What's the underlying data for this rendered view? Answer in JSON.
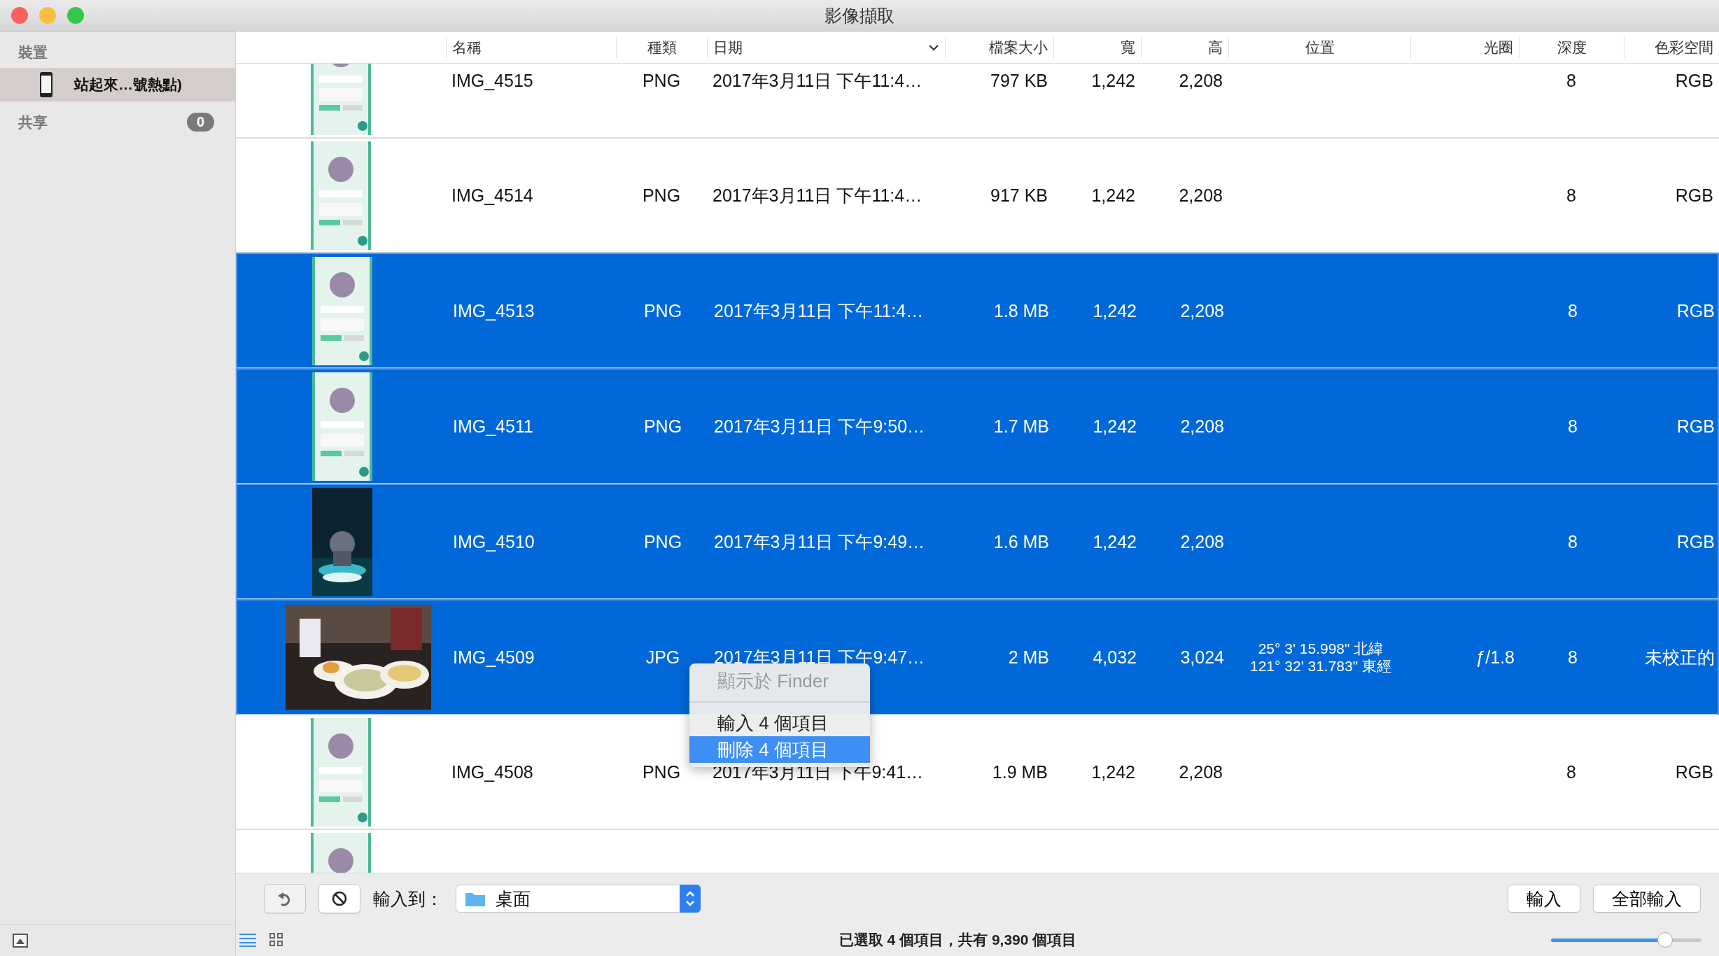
{
  "window": {
    "title": "影像擷取"
  },
  "sidebar": {
    "sections": [
      {
        "title": "裝置",
        "items": [
          {
            "label": "站起來…號熱點)",
            "selected": true,
            "kind": "device"
          }
        ]
      },
      {
        "title": "共享",
        "badge": "0"
      }
    ]
  },
  "table": {
    "columns": [
      {
        "label": "名稱"
      },
      {
        "label": "種類"
      },
      {
        "label": "日期",
        "sorted": true
      },
      {
        "label": "檔案大小"
      },
      {
        "label": "寬"
      },
      {
        "label": "高"
      },
      {
        "label": "位置"
      },
      {
        "label": "光圈"
      },
      {
        "label": "深度"
      },
      {
        "label": "色彩空間"
      }
    ],
    "rows": [
      {
        "selected": false,
        "cells": [
          "IMG_4515",
          "PNG",
          "2017年3月11日 下午11:4…",
          "797 KB",
          "1,242",
          "2,208",
          "",
          "",
          "8",
          "RGB"
        ]
      },
      {
        "selected": false,
        "cells": [
          "IMG_4514",
          "PNG",
          "2017年3月11日 下午11:4…",
          "917 KB",
          "1,242",
          "2,208",
          "",
          "",
          "8",
          "RGB"
        ]
      },
      {
        "selected": true,
        "cells": [
          "IMG_4513",
          "PNG",
          "2017年3月11日 下午11:4…",
          "1.8 MB",
          "1,242",
          "2,208",
          "",
          "",
          "8",
          "RGB"
        ]
      },
      {
        "selected": true,
        "cells": [
          "IMG_4511",
          "PNG",
          "2017年3月11日 下午9:50…",
          "1.7 MB",
          "1,242",
          "2,208",
          "",
          "",
          "8",
          "RGB"
        ]
      },
      {
        "selected": true,
        "cells": [
          "IMG_4510",
          "PNG",
          "2017年3月11日 下午9:49…",
          "1.6 MB",
          "1,242",
          "2,208",
          "",
          "",
          "8",
          "RGB"
        ]
      },
      {
        "selected": true,
        "cells": [
          "IMG_4509",
          "JPG",
          "2017年3月11日 下午9:47…",
          "2 MB",
          "4,032",
          "3,024",
          "25° 3' 15.998\" 北緯\n121° 32' 31.783\" 東經",
          "ƒ/1.8",
          "8",
          "未校正的"
        ]
      },
      {
        "selected": false,
        "cells": [
          "IMG_4508",
          "PNG",
          "2017年3月11日 下午9:41…",
          "1.9 MB",
          "1,242",
          "2,208",
          "",
          "",
          "8",
          "RGB"
        ]
      },
      {
        "selected": false
      }
    ]
  },
  "context_menu": {
    "items": [
      {
        "kind": "item",
        "label": "顯示於 Finder",
        "disabled": true,
        "selected": false
      },
      {
        "kind": "separator"
      },
      {
        "kind": "item",
        "label": "輸入 4 個項目",
        "disabled": false,
        "selected": false
      },
      {
        "kind": "item",
        "label": "刪除 4 個項目",
        "disabled": false,
        "selected": true
      }
    ]
  },
  "toolbar": {
    "import_to_label": "輸入到：",
    "destination": "桌面",
    "import_button": "輸入",
    "import_all_button": "全部輸入"
  },
  "status_bar": {
    "text": "已選取 4 個項目，共有 9,390 個項目",
    "zoom": {
      "level": 0.76
    }
  }
}
